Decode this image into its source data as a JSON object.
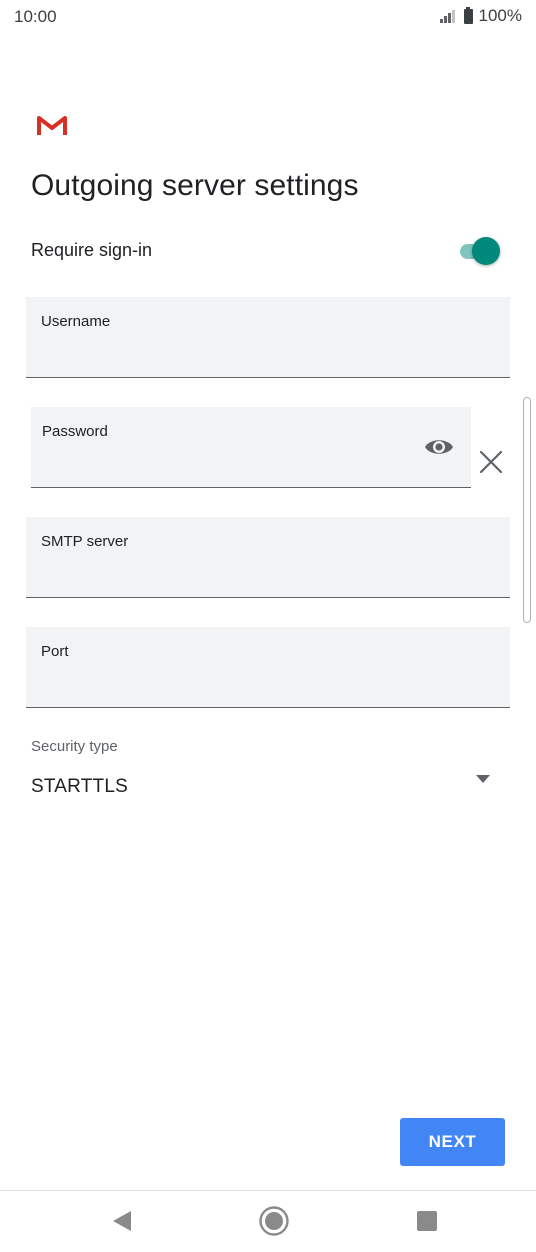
{
  "status_bar": {
    "time": "10:00",
    "battery": "100%"
  },
  "header": {
    "title": "Outgoing server settings"
  },
  "require_signin": {
    "label": "Require sign-in",
    "enabled": true
  },
  "fields": {
    "username": {
      "label": "Username",
      "value": ""
    },
    "password": {
      "label": "Password",
      "value": ""
    },
    "smtp": {
      "label": "SMTP server",
      "value": ""
    },
    "port": {
      "label": "Port",
      "value": ""
    }
  },
  "security": {
    "label": "Security type",
    "value": "STARTTLS"
  },
  "actions": {
    "next_label": "NEXT"
  },
  "icons": {
    "logo": "gmail-logo-icon",
    "toggle": "toggle-switch",
    "visibility": "eye-icon",
    "clear": "close-icon",
    "dropdown": "dropdown-arrow-icon",
    "nav": [
      "back-icon",
      "home-icon",
      "recents-icon"
    ]
  },
  "colors": {
    "accent": "#00897b",
    "button": "#4285f4",
    "field_bg": "#f1f3f4"
  }
}
